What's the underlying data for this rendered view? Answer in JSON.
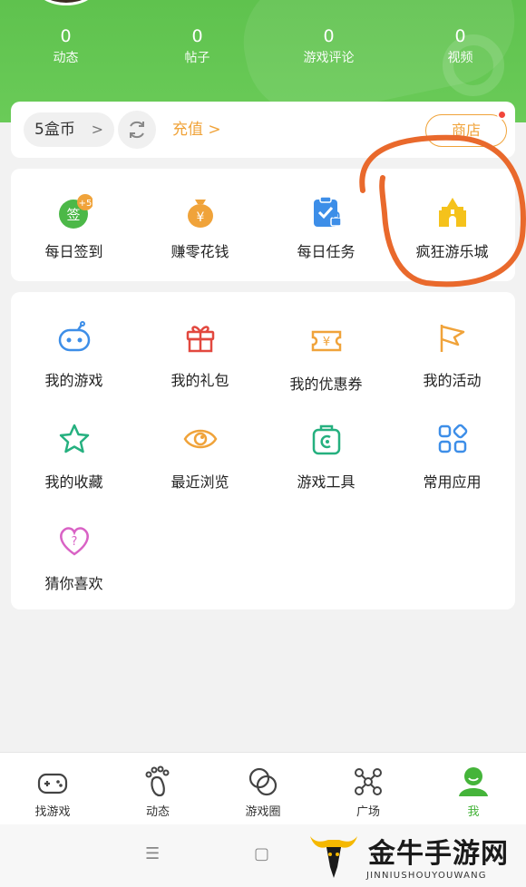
{
  "stats": [
    {
      "value": "0",
      "label": "动态"
    },
    {
      "value": "0",
      "label": "帖子"
    },
    {
      "value": "0",
      "label": "游戏评论"
    },
    {
      "value": "0",
      "label": "视频"
    }
  ],
  "wallet": {
    "coins": "5盒币",
    "recharge": "充值 >",
    "shop": "商店"
  },
  "quick_actions": [
    {
      "label": "每日签到",
      "icon": "sign-in-icon",
      "badge": "+5",
      "badge_icon_text": "签"
    },
    {
      "label": "赚零花钱",
      "icon": "money-bag-icon",
      "badge_icon_text": "¥"
    },
    {
      "label": "每日任务",
      "icon": "task-clipboard-icon"
    },
    {
      "label": "疯狂游乐城",
      "icon": "castle-icon"
    }
  ],
  "menu": [
    {
      "label": "我的游戏",
      "icon": "gamepad-icon"
    },
    {
      "label": "我的礼包",
      "icon": "gift-icon"
    },
    {
      "label": "我的优惠券",
      "icon": "coupon-icon"
    },
    {
      "label": "我的活动",
      "icon": "flag-icon"
    },
    {
      "label": "我的收藏",
      "icon": "star-icon"
    },
    {
      "label": "最近浏览",
      "icon": "eye-icon"
    },
    {
      "label": "游戏工具",
      "icon": "toolbox-icon"
    },
    {
      "label": "常用应用",
      "icon": "apps-icon"
    },
    {
      "label": "猜你喜欢",
      "icon": "heart-question-icon"
    }
  ],
  "bottom_nav": [
    {
      "label": "找游戏",
      "icon": "controller-icon"
    },
    {
      "label": "动态",
      "icon": "footprint-icon"
    },
    {
      "label": "游戏圈",
      "icon": "circles-icon"
    },
    {
      "label": "广场",
      "icon": "network-icon"
    },
    {
      "label": "我",
      "icon": "person-icon",
      "active": true
    }
  ],
  "system_bar": {
    "menu": "☰",
    "home": "▢"
  },
  "watermark": {
    "title": "金牛手游网",
    "subtitle": "JINNIUSHOUYOUWANG"
  },
  "colors": {
    "brand_green": "#5fc24e",
    "accent_orange": "#f0a33a",
    "active_green": "#45b43a",
    "annotation": "#e9692c"
  }
}
